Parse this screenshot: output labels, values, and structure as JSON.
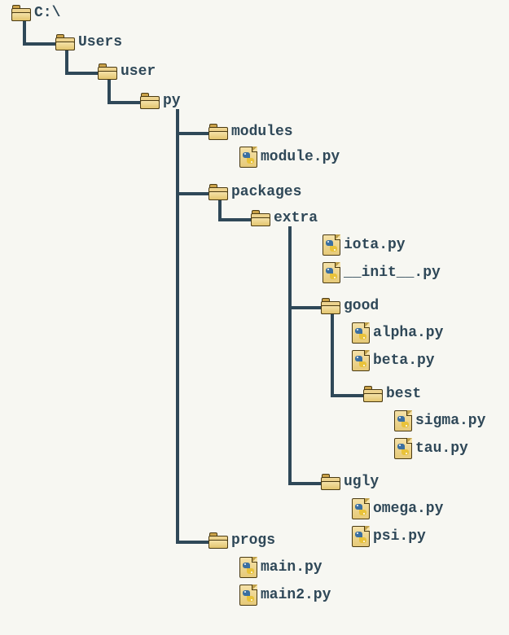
{
  "root": {
    "label": "C:\\"
  },
  "users": {
    "label": "Users"
  },
  "user": {
    "label": "user"
  },
  "py": {
    "label": "py"
  },
  "modules": {
    "label": "modules"
  },
  "module_py": {
    "label": "module.py"
  },
  "packages": {
    "label": "packages"
  },
  "extra": {
    "label": "extra"
  },
  "iota_py": {
    "label": "iota.py"
  },
  "init_py": {
    "label": "__init__.py"
  },
  "good": {
    "label": "good"
  },
  "alpha_py": {
    "label": "alpha.py"
  },
  "beta_py": {
    "label": "beta.py"
  },
  "best": {
    "label": "best"
  },
  "sigma_py": {
    "label": "sigma.py"
  },
  "tau_py": {
    "label": "tau.py"
  },
  "ugly": {
    "label": "ugly"
  },
  "omega_py": {
    "label": "omega.py"
  },
  "psi_py": {
    "label": "psi.py"
  },
  "progs": {
    "label": "progs"
  },
  "main_py": {
    "label": "main.py"
  },
  "main2_py": {
    "label": "main2.py"
  }
}
